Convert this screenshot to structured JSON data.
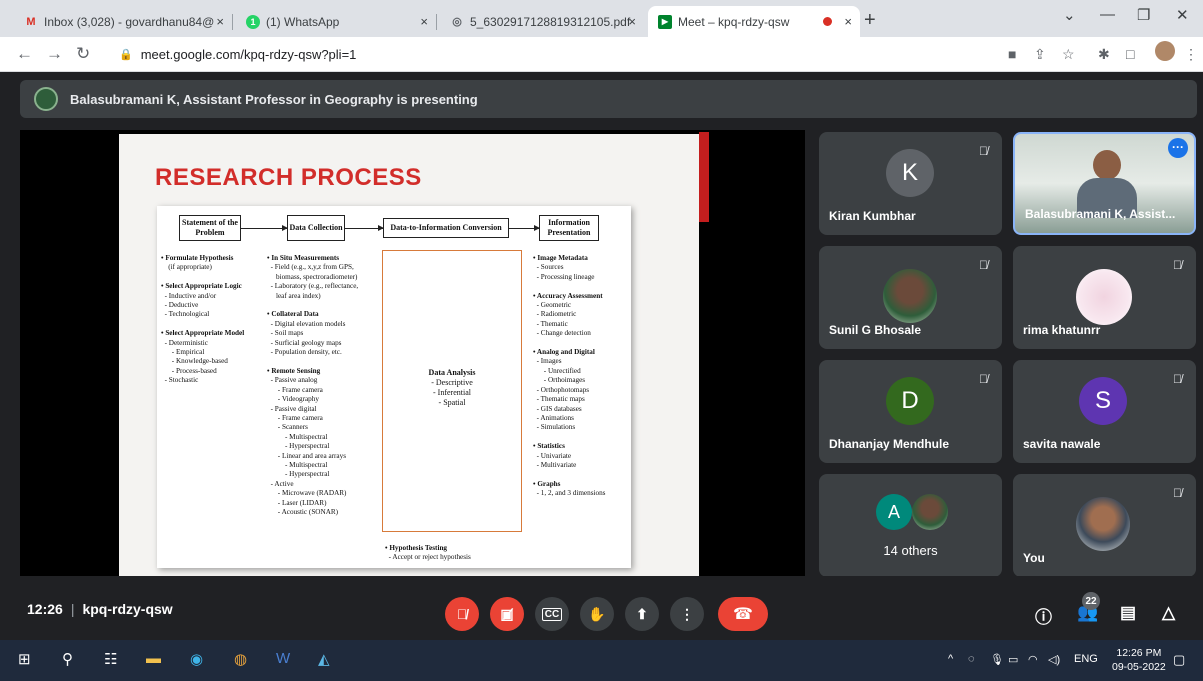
{
  "browser": {
    "tabs": [
      {
        "icon": "gmail-icon",
        "title": "Inbox (3,028) - govardhanu84@",
        "close": "×"
      },
      {
        "icon": "whatsapp-icon",
        "title": "(1) WhatsApp",
        "close": "×"
      },
      {
        "icon": "pdf-globe-icon",
        "title": "5_6302917128819312105.pdf",
        "close": "×"
      },
      {
        "icon": "meet-icon",
        "title": "Meet – kpq-rdzy-qsw",
        "close": "×"
      }
    ],
    "new_tab": "+",
    "window_controls": [
      "⌄",
      "—",
      "❐",
      "✕"
    ],
    "url": "meet.google.com/kpq-rdzy-qsw?pli=1"
  },
  "presenter_banner": "Balasubramani K, Assistant Professor in Geography is presenting",
  "slide": {
    "title": "RESEARCH PROCESS",
    "headers": [
      "Statement of the Problem",
      "Data Collection",
      "Data-to-Information Conversion",
      "Information Presentation"
    ],
    "col1": [
      {
        "t": "• Formulate Hypothesis",
        "b": true
      },
      {
        "t": "    (if appropriate)"
      },
      {
        "t": " "
      },
      {
        "t": "• Select Appropriate Logic",
        "b": true
      },
      {
        "t": "  - Inductive and/or"
      },
      {
        "t": "  - Deductive"
      },
      {
        "t": "  - Technological"
      },
      {
        "t": " "
      },
      {
        "t": "• Select Appropriate Model",
        "b": true
      },
      {
        "t": "  - Deterministic"
      },
      {
        "t": "      - Empirical"
      },
      {
        "t": "      - Knowledge-based"
      },
      {
        "t": "      - Process-based"
      },
      {
        "t": "  - Stochastic"
      }
    ],
    "col2": [
      {
        "t": "• In Situ Measurements",
        "b": true
      },
      {
        "t": "  - Field (e.g., x,y,z from GPS,"
      },
      {
        "t": "     biomass, spectroradiometer)"
      },
      {
        "t": "  - Laboratory (e.g., reflectance,"
      },
      {
        "t": "     leaf area index)"
      },
      {
        "t": " "
      },
      {
        "t": "• Collateral Data",
        "b": true
      },
      {
        "t": "  - Digital elevation models"
      },
      {
        "t": "  - Soil maps"
      },
      {
        "t": "  - Surficial geology maps"
      },
      {
        "t": "  - Population density, etc."
      },
      {
        "t": " "
      },
      {
        "t": "• Remote Sensing",
        "b": true
      },
      {
        "t": "  - Passive analog"
      },
      {
        "t": "      - Frame camera"
      },
      {
        "t": "      - Videography"
      },
      {
        "t": "  - Passive digital"
      },
      {
        "t": "      - Frame camera"
      },
      {
        "t": "      - Scanners"
      },
      {
        "t": "          - Multispectral"
      },
      {
        "t": "          - Hyperspectral"
      },
      {
        "t": "      - Linear and area arrays"
      },
      {
        "t": "          - Multispectral"
      },
      {
        "t": "          - Hyperspectral"
      },
      {
        "t": "  - Active"
      },
      {
        "t": "      - Microwave (RADAR)"
      },
      {
        "t": "      - Laser (LIDAR)"
      },
      {
        "t": "      - Acoustic (SONAR)"
      }
    ],
    "analysis": [
      "Data Analysis",
      "- Descriptive",
      "- Inferential",
      "- Spatial"
    ],
    "hypothesis": [
      {
        "t": "• Hypothesis Testing",
        "b": true
      },
      {
        "t": "  - Accept or reject hypothesis"
      }
    ],
    "col4": [
      {
        "t": "• Image Metadata",
        "b": true
      },
      {
        "t": "  - Sources"
      },
      {
        "t": "  - Processing lineage"
      },
      {
        "t": " "
      },
      {
        "t": "• Accuracy Assessment",
        "b": true
      },
      {
        "t": "  - Geometric"
      },
      {
        "t": "  - Radiometric"
      },
      {
        "t": "  - Thematic"
      },
      {
        "t": "  - Change detection"
      },
      {
        "t": " "
      },
      {
        "t": "• Analog and Digital",
        "b": true
      },
      {
        "t": "  - Images"
      },
      {
        "t": "      - Unrectified"
      },
      {
        "t": "      - Orthoimages"
      },
      {
        "t": "  - Orthophotomaps"
      },
      {
        "t": "  - Thematic maps"
      },
      {
        "t": "  - GIS databases"
      },
      {
        "t": "  - Animations"
      },
      {
        "t": "  - Simulations"
      },
      {
        "t": " "
      },
      {
        "t": "• Statistics",
        "b": true
      },
      {
        "t": "  - Univariate"
      },
      {
        "t": "  - Multivariate"
      },
      {
        "t": " "
      },
      {
        "t": "• Graphs",
        "b": true
      },
      {
        "t": "  - 1, 2, and 3 dimensions"
      }
    ]
  },
  "participants": {
    "kiran": {
      "name": "Kiran Kumbhar",
      "initial": "K",
      "color": "#3c4043"
    },
    "bala": {
      "name": "Balasubramani K, Assist..."
    },
    "sunil": {
      "name": "Sunil G Bhosale"
    },
    "rima": {
      "name": "rima khatunrr"
    },
    "dhananjay": {
      "name": "Dhananjay Mendhule",
      "initial": "D",
      "color": "#33691e"
    },
    "savita": {
      "name": "savita nawale",
      "initial": "S",
      "color": "#5e35b1"
    },
    "others": {
      "name": "14 others",
      "initial": "A",
      "color": "#00897b"
    },
    "you": {
      "name": "You"
    }
  },
  "meeting": {
    "time": "12:26",
    "code": "kpq-rdzy-qsw",
    "people_count": "22"
  },
  "taskbar": {
    "lang": "ENG",
    "time": "12:26 PM",
    "date": "09-05-2022"
  }
}
